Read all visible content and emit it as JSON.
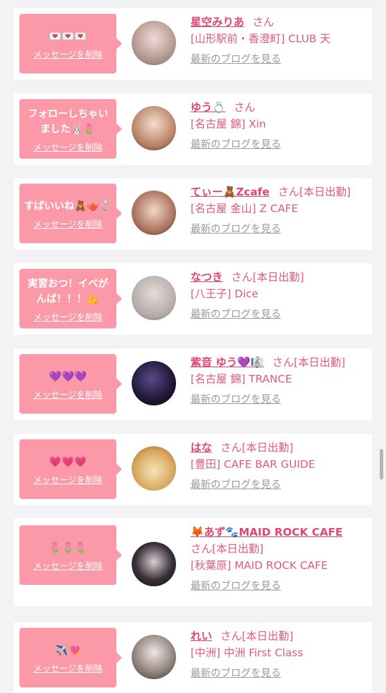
{
  "items": [
    {
      "message": "💌💌💌",
      "delete_label": "メッセージを削除",
      "name": "星空みりあ",
      "san": "さん",
      "status": "",
      "shop": "[山形駅前・香澄町] CLUB 天",
      "blog": "最新のブログを見る"
    },
    {
      "message": "フォローしちゃいました🐰🌷",
      "delete_label": "メッセージを削除",
      "name": "ゆう💍",
      "san": "さん",
      "status": "",
      "shop": "[名古屋 錦] Xin",
      "blog": "最新のブログを見る"
    },
    {
      "message": "すばいいね🧸🫖💍",
      "delete_label": "メッセージを削除",
      "name": "てぃー🧸Zcafe",
      "san": "さん",
      "status": "[本日出勤]",
      "shop": "[名古屋 金山] Z CAFE",
      "blog": "最新のブログを見る"
    },
    {
      "message": "実習おつ！イベがんば！！！💪",
      "delete_label": "メッセージを削除",
      "name": "なつき",
      "san": "さん",
      "status": "[本日出勤]",
      "shop": "[八王子] Dice",
      "blog": "最新のブログを見る"
    },
    {
      "message": "💜💜💜",
      "delete_label": "メッセージを削除",
      "name": "紫音 ゆう💜🎼",
      "san": "さん",
      "status": "[本日出勤]",
      "shop": "[名古屋 錦] TRANCE",
      "blog": "最新のブログを見る"
    },
    {
      "message": "💗💗💗",
      "delete_label": "メッセージを削除",
      "name": "はな",
      "san": "さん",
      "status": "[本日出勤]",
      "shop": "[豊田] CAFE BAR GUIDE",
      "blog": "最新のブログを見る"
    },
    {
      "message": "🌷🌷🌷",
      "delete_label": "メッセージを削除",
      "name": "🦊あず🐾MAID ROCK CAFE",
      "san": "さん",
      "status": "[本日出勤]",
      "shop": "[秋葉原] MAID ROCK CAFE",
      "blog": "最新のブログを見る"
    },
    {
      "message": "✈️💘",
      "delete_label": "メッセージを削除",
      "name": "れい",
      "san": "さん",
      "status": "[本日出勤]",
      "shop": "[中洲] 中洲 First Class",
      "blog": "最新のブログを見る"
    }
  ],
  "colors": {
    "bubble": "#fb99a8",
    "name": "#e2466c",
    "shop": "#e05a78",
    "blog": "#9a9a9a"
  }
}
